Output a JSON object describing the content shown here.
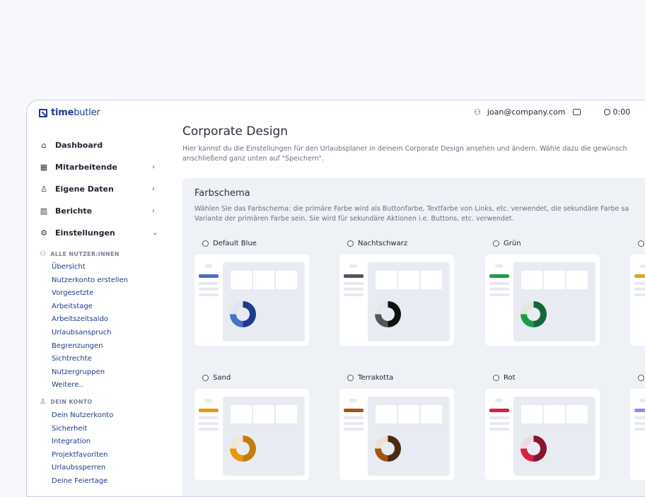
{
  "app": {
    "logo_bold": "time",
    "logo_rest": "butler",
    "email": "joan@company.com",
    "timer": "0:00"
  },
  "sidebar": {
    "nav": [
      {
        "label": "Dashboard",
        "icon": "home-icon"
      },
      {
        "label": "Mitarbeitende",
        "icon": "building-icon",
        "chevron": "›"
      },
      {
        "label": "Eigene Daten",
        "icon": "user-icon",
        "chevron": "›"
      },
      {
        "label": "Berichte",
        "icon": "chart-icon",
        "chevron": "›"
      },
      {
        "label": "Einstellungen",
        "icon": "gear-icon",
        "chevron": "⌄"
      }
    ],
    "group_all": {
      "heading": "ALLE NUTZER:INNEN",
      "items": [
        "Übersicht",
        "Nutzerkonto erstellen",
        "Vorgesetzte",
        "Arbeitstage",
        "Arbeitszeitsaldo",
        "Urlaubsanspruch",
        "Begrenzungen",
        "Sichtrechte",
        "Nutzergruppen",
        "Weitere.."
      ]
    },
    "group_mine": {
      "heading": "DEIN KONTO",
      "items": [
        "Dein Nutzerkonto",
        "Sicherheit",
        "Integration",
        "Projektfavoriten",
        "Urlaubssperren",
        "Deine Feiertage"
      ]
    }
  },
  "main": {
    "title": "Corporate Design",
    "desc_line1": "Hier kannst du die Einstellungen für den Urlaubsplaner in deinem Corporate Design ansehen und ändern. Wähle dazu die gewünsch",
    "desc_line2": "anschließend ganz unten auf \"Speichern\"."
  },
  "colorscheme": {
    "title": "Farbschema",
    "desc_line1": "Wählen Sie das Farbschema: die primäre Farbe wird als Buttonfarbe, Textfarbe von Links, etc. verwendet, die sekundäre Farbe sa",
    "desc_line2": "Variante der primären Farbe sein. Sie wird für sekundäre Aktionen i.e. Buttons, etc. verwendet.",
    "schemes": [
      {
        "label": "Default Blue",
        "primary": "#4a6fc4",
        "dark": "#1d3b8a",
        "light": "#dfe5f3"
      },
      {
        "label": "Nachtschwarz",
        "primary": "#555555",
        "dark": "#111111",
        "light": "#e4e6ea"
      },
      {
        "label": "Grün",
        "primary": "#1f9a45",
        "dark": "#17653a",
        "light": "#dfe9e2"
      },
      {
        "label": "",
        "primary": "#e3a516",
        "dark": "#b98108",
        "light": "#f3ead1"
      },
      {
        "label": "Sand",
        "primary": "#e8970f",
        "dark": "#c67c0b",
        "light": "#f4e6cf"
      },
      {
        "label": "Terrakotta",
        "primary": "#a0560f",
        "dark": "#4e2a0c",
        "light": "#ecdfd3"
      },
      {
        "label": "Rot",
        "primary": "#d8203f",
        "dark": "#8a1430",
        "light": "#f1d9de"
      },
      {
        "label": "",
        "primary": "#9d88e8",
        "dark": "#7057c9",
        "light": "#e6e1f6"
      }
    ]
  }
}
